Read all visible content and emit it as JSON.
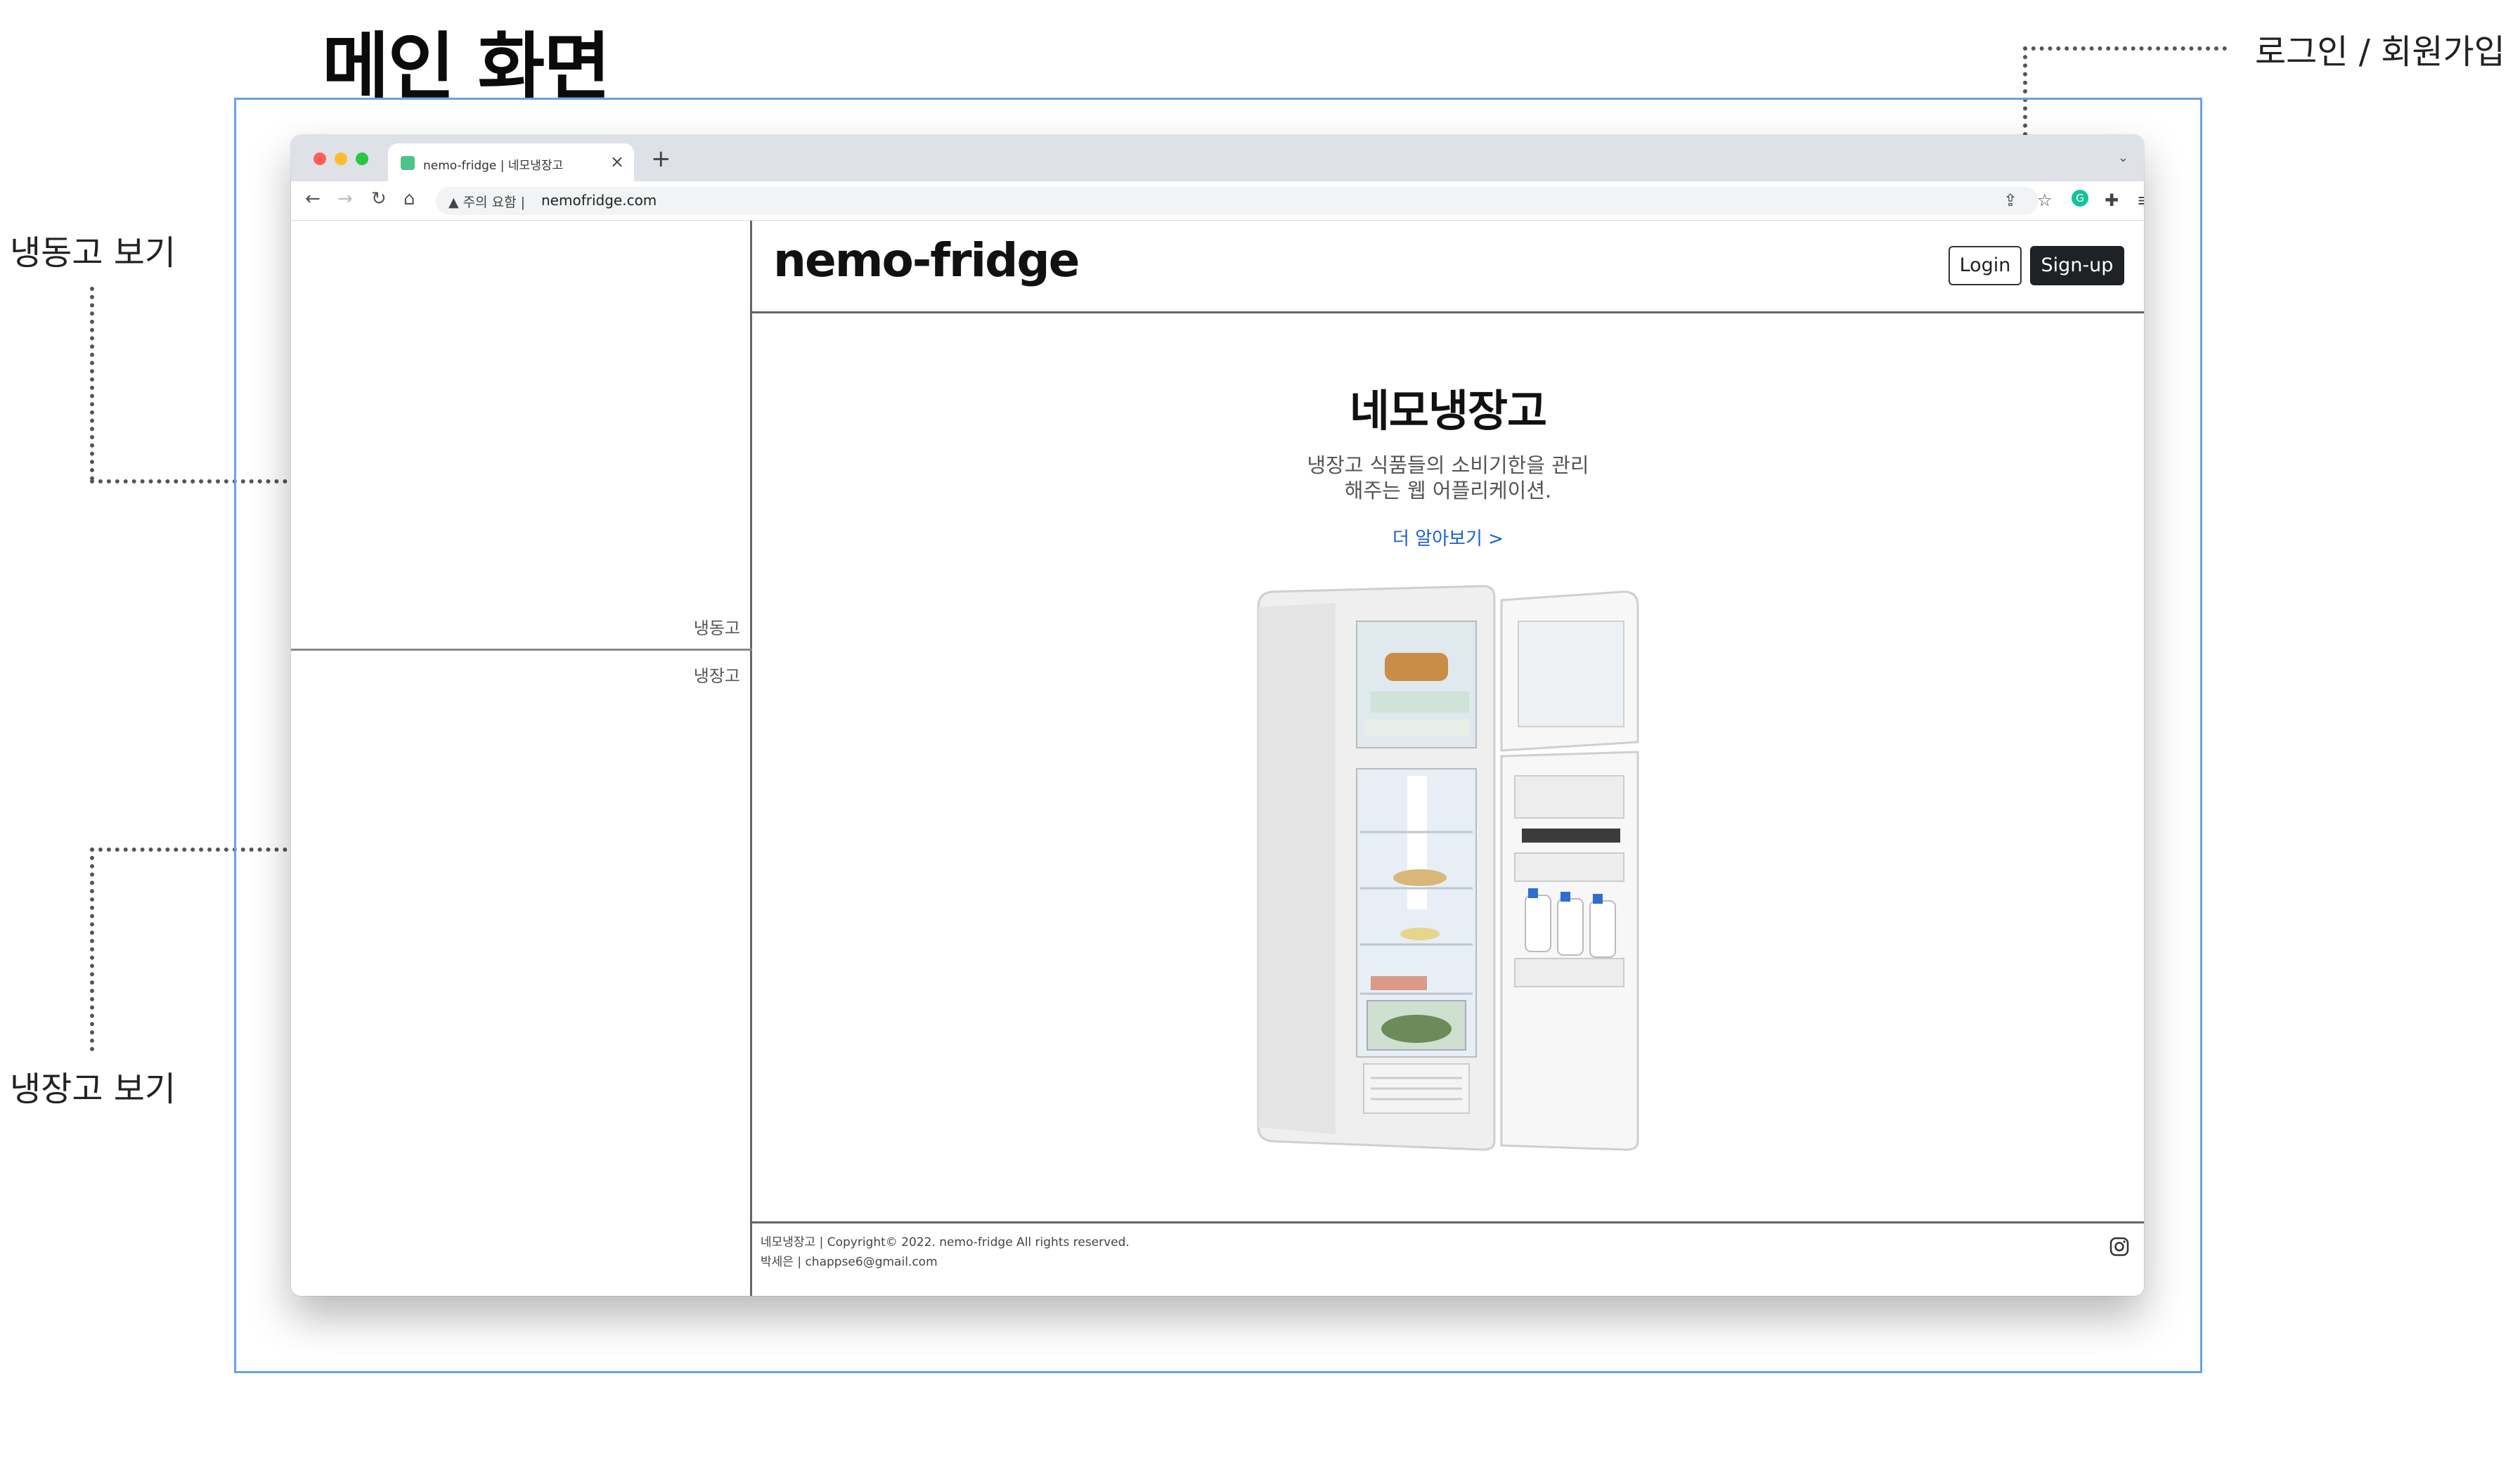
{
  "annotations": {
    "page_title": "메인 화면",
    "login_note": "로그인 / 회원가입",
    "freezer_note": "냉동고 보기",
    "fridge_note": "냉장고 보기"
  },
  "browser": {
    "tab_title": "nemo-fridge | 네모냉장고",
    "tab_close": "×",
    "new_tab": "+",
    "security_warning": "주의 요함",
    "url": "nemofridge.com"
  },
  "sidebar": {
    "freezer_label": "냉동고",
    "fridge_label": "냉장고"
  },
  "header": {
    "logo": "nemo-fridge",
    "login_label": "Login",
    "signup_label": "Sign-up"
  },
  "hero": {
    "title": "네모냉장고",
    "desc_line1": "냉장고 식품들의 소비기한을 관리",
    "desc_line2": "해주는 웹 어플리케이션.",
    "link": "더 알아보기 >"
  },
  "footer": {
    "line1": "네모냉장고 | Copyright© 2022. nemo-fridge All rights reserved.",
    "line2": "박세은 | chappse6@gmail.com"
  },
  "icons": [
    "back-icon",
    "forward-icon",
    "reload-icon",
    "home-icon",
    "warning-icon",
    "share-icon",
    "star-icon",
    "grammarly-icon",
    "extensions-icon",
    "reading-list-icon",
    "side-panel-icon",
    "profile-icon",
    "menu-icon",
    "instagram-icon"
  ],
  "colors": {
    "annotation_frame": "#6aa1e6",
    "signup_button": "#1f2225",
    "link": "#1a5fcf"
  }
}
